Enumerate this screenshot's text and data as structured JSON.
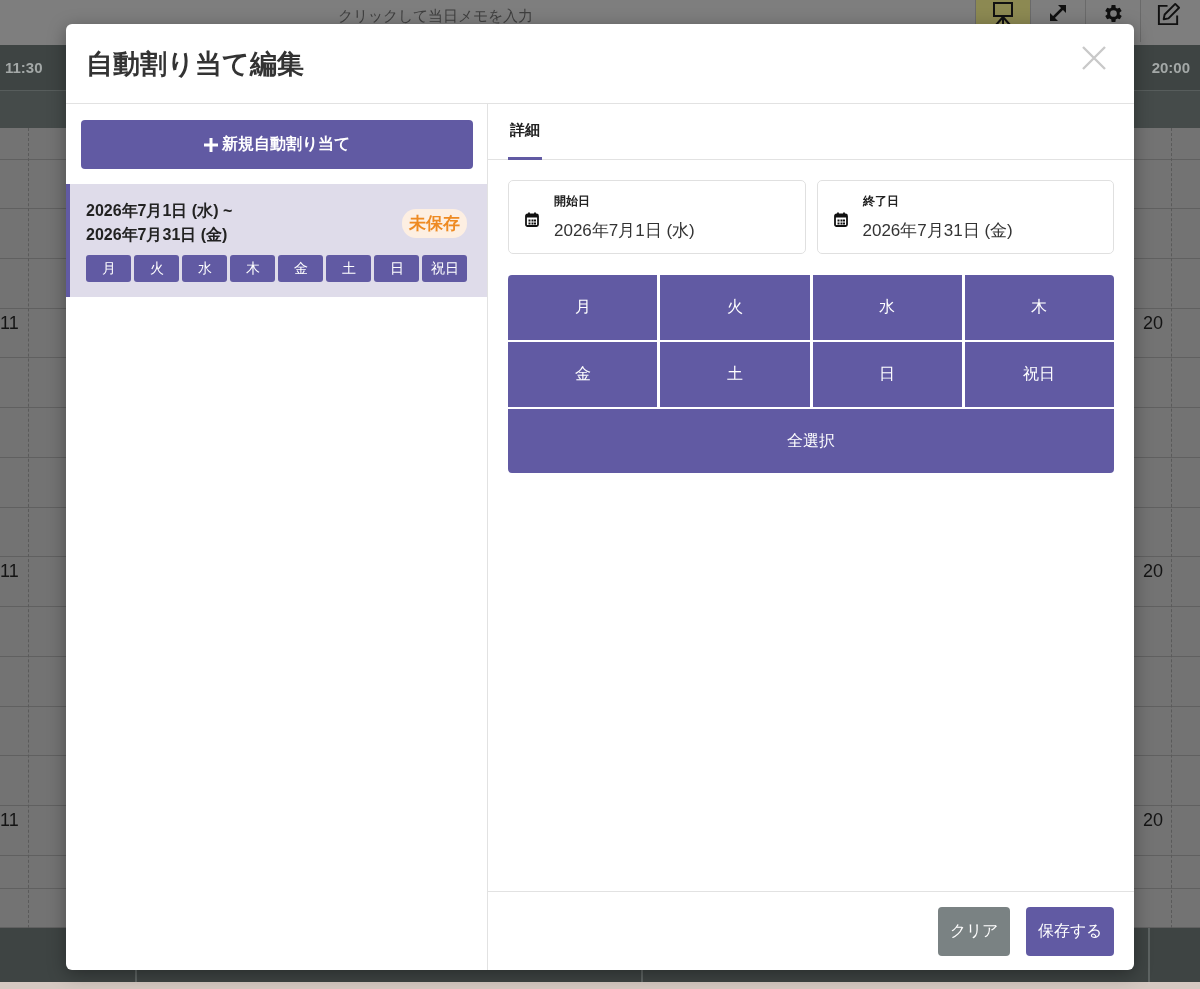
{
  "app": {
    "memo": {
      "placeholder": "クリックして当日メモを入力"
    },
    "toolbar": [
      {
        "selected": true
      },
      {
        "selected": false
      },
      {
        "selected": false
      },
      {
        "selected": false
      }
    ],
    "timeline": {
      "start_time": "11:30",
      "end_time": "20:00",
      "left_labels": [
        "11",
        "11",
        "11"
      ],
      "right_labels": [
        "20",
        "20",
        "20"
      ]
    }
  },
  "dialog": {
    "title": "自動割り当て編集"
  },
  "sidebar": {
    "new_button": "新規自動割り当て",
    "items": [
      {
        "selected": true,
        "start": "2026年7月1日 (水) ~",
        "end": "2026年7月31日 (金)",
        "badge": "未保存",
        "days": [
          "月",
          "火",
          "水",
          "木",
          "金",
          "土",
          "日",
          "祝日"
        ]
      }
    ]
  },
  "detail": {
    "tabs": [
      {
        "label": "詳細",
        "selected": true
      }
    ],
    "start_date": {
      "label": "開始日",
      "value": "2026年7月1日 (水)"
    },
    "end_date": {
      "label": "終了日",
      "value": "2026年7月31日 (金)"
    },
    "weekdays": [
      {
        "label": "月",
        "selected": true
      },
      {
        "label": "火",
        "selected": true
      },
      {
        "label": "水",
        "selected": true
      },
      {
        "label": "木",
        "selected": true
      },
      {
        "label": "金",
        "selected": true
      },
      {
        "label": "土",
        "selected": true
      },
      {
        "label": "日",
        "selected": true
      },
      {
        "label": "祝日",
        "selected": true
      }
    ],
    "select_all": "全選択"
  },
  "footer": {
    "buttons": [
      {
        "label": "クリア",
        "kind": "secondary"
      },
      {
        "label": "保存する",
        "kind": "primary"
      }
    ]
  }
}
